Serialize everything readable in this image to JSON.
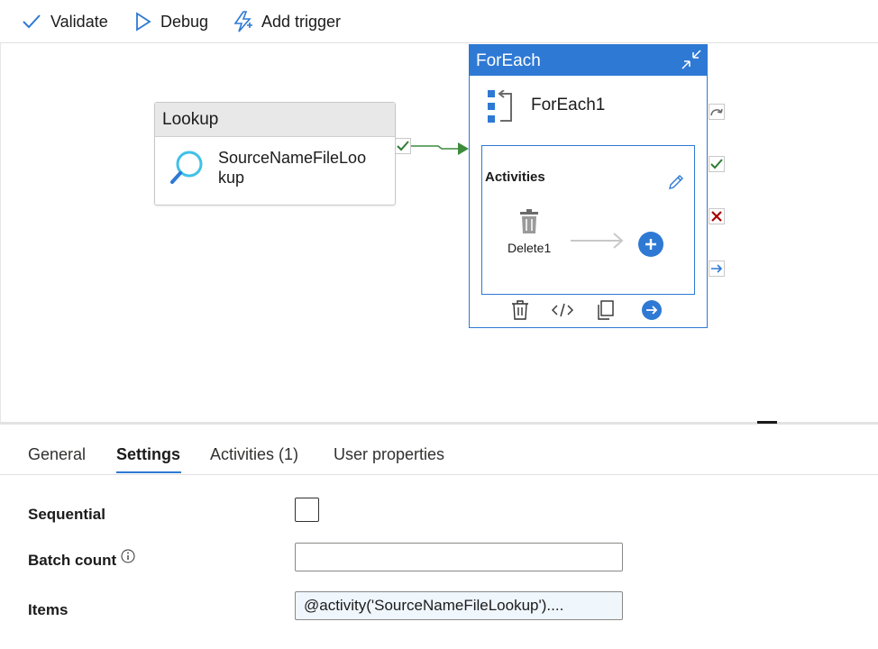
{
  "toolbar": {
    "validate_label": "Validate",
    "debug_label": "Debug",
    "add_trigger_label": "Add trigger"
  },
  "lookup_activity": {
    "type_label": "Lookup",
    "name": "SourceNameFileLookup",
    "icon": "search-icon"
  },
  "foreach_activity": {
    "type_label": "ForEach",
    "name": "ForEach1",
    "icon": "foreach-icon",
    "activities_title": "Activities",
    "inner_activity": {
      "name": "Delete1",
      "icon": "trash-icon"
    },
    "actions": [
      "delete-icon",
      "code-icon",
      "copy-icon",
      "go-arrow-icon"
    ]
  },
  "side_outputs": [
    "skip-icon",
    "success-check-icon",
    "failure-x-icon",
    "completion-arrow-icon"
  ],
  "tabs": [
    {
      "label": "General"
    },
    {
      "label": "Settings",
      "active": true
    },
    {
      "label": "Activities (1)"
    },
    {
      "label": "User properties"
    }
  ],
  "settings": {
    "sequential_label": "Sequential",
    "sequential_checked": false,
    "batch_count_label": "Batch count",
    "batch_count_value": "",
    "items_label": "Items",
    "items_value": "@activity('SourceNameFileLookup')...."
  },
  "colors": {
    "accent": "#2e79d4",
    "success": "#2e7d32",
    "failure": "#a80000"
  }
}
